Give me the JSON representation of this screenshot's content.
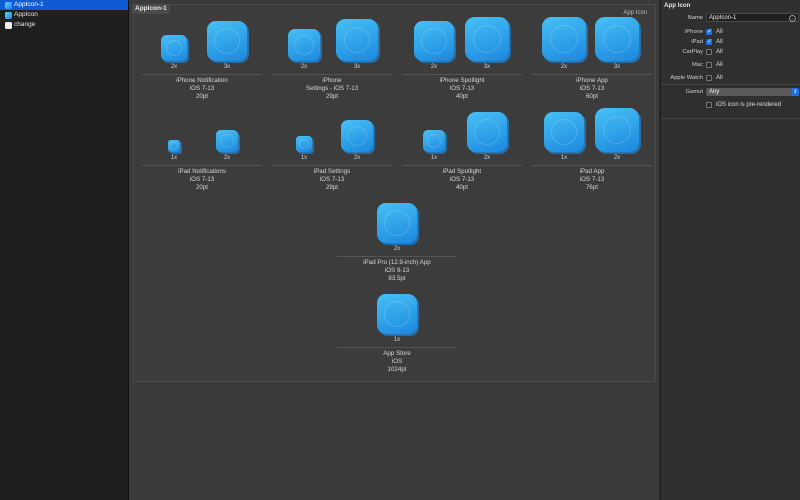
{
  "sidebar": {
    "items": [
      {
        "label": "AppIcon-1",
        "icon": "app-icon",
        "selected": true
      },
      {
        "label": "AppIcon",
        "icon": "app-icon",
        "selected": false
      },
      {
        "label": "change",
        "icon": "blank-icon",
        "selected": false
      }
    ]
  },
  "panel": {
    "tag": "AppIcon-1",
    "kind": "App Icon",
    "groups": [
      {
        "lines": [
          "iPhone Notification",
          "iOS 7-13",
          "20pt"
        ],
        "scales": [
          "2x",
          "3x"
        ]
      },
      {
        "lines": [
          "iPhone",
          "Settings - iOS 7-13",
          "29pt"
        ],
        "scales": [
          "2x",
          "3x"
        ]
      },
      {
        "lines": [
          "iPhone Spotlight",
          "iOS 7-13",
          "40pt"
        ],
        "scales": [
          "2x",
          "3x"
        ]
      },
      {
        "lines": [
          "iPhone App",
          "iOS 7-13",
          "60pt"
        ],
        "scales": [
          "2x",
          "3x"
        ]
      },
      {
        "lines": [
          "iPad Notifications",
          "iOS 7-13",
          "20pt"
        ],
        "scales": [
          "1x",
          "2x"
        ]
      },
      {
        "lines": [
          "iPad Settings",
          "iOS 7-13",
          "29pt"
        ],
        "scales": [
          "1x",
          "2x"
        ]
      },
      {
        "lines": [
          "iPad Spotlight",
          "iOS 7-13",
          "40pt"
        ],
        "scales": [
          "1x",
          "2x"
        ]
      },
      {
        "lines": [
          "iPad App",
          "iOS 7-13",
          "76pt"
        ],
        "scales": [
          "1x",
          "2x"
        ]
      },
      {
        "lines": [
          "iPad Pro (12.9-inch) App",
          "iOS 9-13",
          "83.5pt"
        ],
        "scales": [
          "2x"
        ]
      },
      {
        "lines": [
          "App Store",
          "iOS",
          "1024pt"
        ],
        "scales": [
          "1x"
        ]
      }
    ]
  },
  "inspector": {
    "title": "App Icon",
    "name_label": "Name",
    "name_value": "AppIcon-1",
    "devices": [
      {
        "label": "iPhone",
        "option": "All",
        "checked": true
      },
      {
        "label": "iPad",
        "option": "All",
        "checked": true
      },
      {
        "label": "CarPlay",
        "option": "All",
        "checked": false
      },
      {
        "label": "Mac",
        "option": "All",
        "checked": false
      },
      {
        "label": "Apple Watch",
        "option": "All",
        "checked": false
      }
    ],
    "gamut_label": "Gamut",
    "gamut_value": "Any",
    "prerendered_label": "iOS icon is pre-rendered",
    "prerendered_checked": false
  },
  "colors": {
    "selection": "#0f5bd4",
    "icon_top": "#48c8ff",
    "icon_bottom": "#1a8ce8",
    "checkbox_on": "#1a73e8"
  }
}
